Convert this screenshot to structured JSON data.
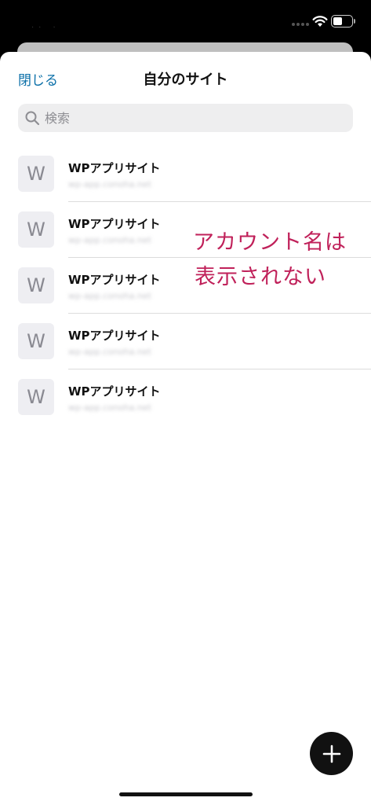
{
  "status_bar": {
    "icons": [
      "cellular-signal-icon",
      "wifi-icon",
      "battery-icon"
    ],
    "battery_level": 0.5
  },
  "header": {
    "close_label": "閉じる",
    "title": "自分のサイト"
  },
  "search": {
    "placeholder": "検索",
    "value": ""
  },
  "sites": [
    {
      "avatar": "W",
      "name": "WPアプリサイト",
      "url": "wp-app.conoha.net"
    },
    {
      "avatar": "W",
      "name": "WPアプリサイト",
      "url": "wp-app.conoha.net"
    },
    {
      "avatar": "W",
      "name": "WPアプリサイト",
      "url": "wp-app.conoha.net"
    },
    {
      "avatar": "W",
      "name": "WPアプリサイト",
      "url": "wp-app.conoha.net"
    },
    {
      "avatar": "W",
      "name": "WPアプリサイト",
      "url": "wp-app.conoha.net"
    }
  ],
  "annotation": {
    "line1": "アカウント名は",
    "line2": "表示されない"
  },
  "fab": {
    "icon": "plus-icon"
  },
  "colors": {
    "accent": "#0a6fa8",
    "annotation": "#c0215a",
    "fab": "#111111"
  }
}
